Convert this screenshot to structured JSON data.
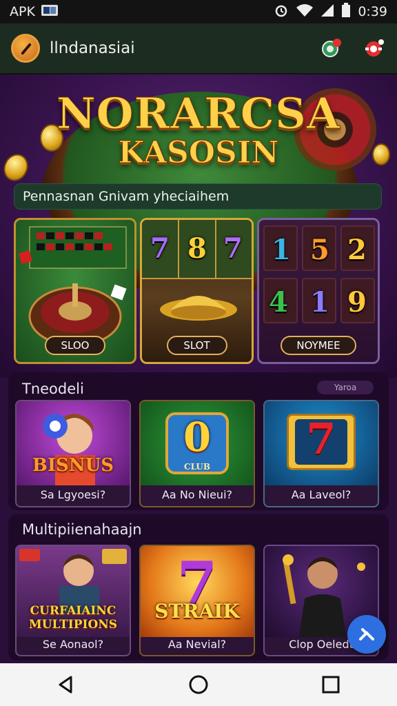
{
  "status_bar": {
    "left_label": "APK",
    "time": "0:39"
  },
  "app_bar": {
    "title": "llndanasiai"
  },
  "hero": {
    "title_line1": "NORARCSA",
    "title_line2": "KASOSIN",
    "subtitle": "Pennasnan Gnivam yheciaihem",
    "games": [
      {
        "label": "SLOO"
      },
      {
        "label": "SLOT",
        "reels": [
          "7",
          "8",
          "7"
        ]
      },
      {
        "label": "NOYMEE",
        "reels": [
          "1",
          "5",
          "2",
          "4",
          "1",
          "9"
        ]
      }
    ]
  },
  "section1": {
    "title": "Tneodeli",
    "tag": "Yaroa",
    "cards": [
      {
        "thumb_text": "BISNUS",
        "caption": "Sa Lgyoesi?"
      },
      {
        "thumb_text": "0",
        "thumb_sub": "CLUB",
        "caption": "Aa No Nieui?"
      },
      {
        "thumb_text": "7",
        "caption": "Aa Laveol?"
      }
    ]
  },
  "section2": {
    "title": "Multipiienahaajn",
    "cards": [
      {
        "thumb_text": "CURFAIAINC MULTIPIONS",
        "caption": "Se Aonaol?"
      },
      {
        "thumb_text": "STRAIK",
        "thumb_num": "7",
        "caption": "Aa Nevial?"
      },
      {
        "caption": "Clop Oeledt"
      }
    ]
  },
  "colors": {
    "app_bar": "#1d2c20",
    "accent_gold": "#ffd14a",
    "fab": "#2d6fe0",
    "background": "#2a0f3a"
  },
  "icons": [
    "gallery-icon",
    "alarm-icon",
    "wifi-icon",
    "signal-icon",
    "battery-icon",
    "app-logo-icon",
    "chip-icon",
    "notification-icon",
    "share-icon",
    "back-icon",
    "home-icon",
    "recents-icon"
  ]
}
